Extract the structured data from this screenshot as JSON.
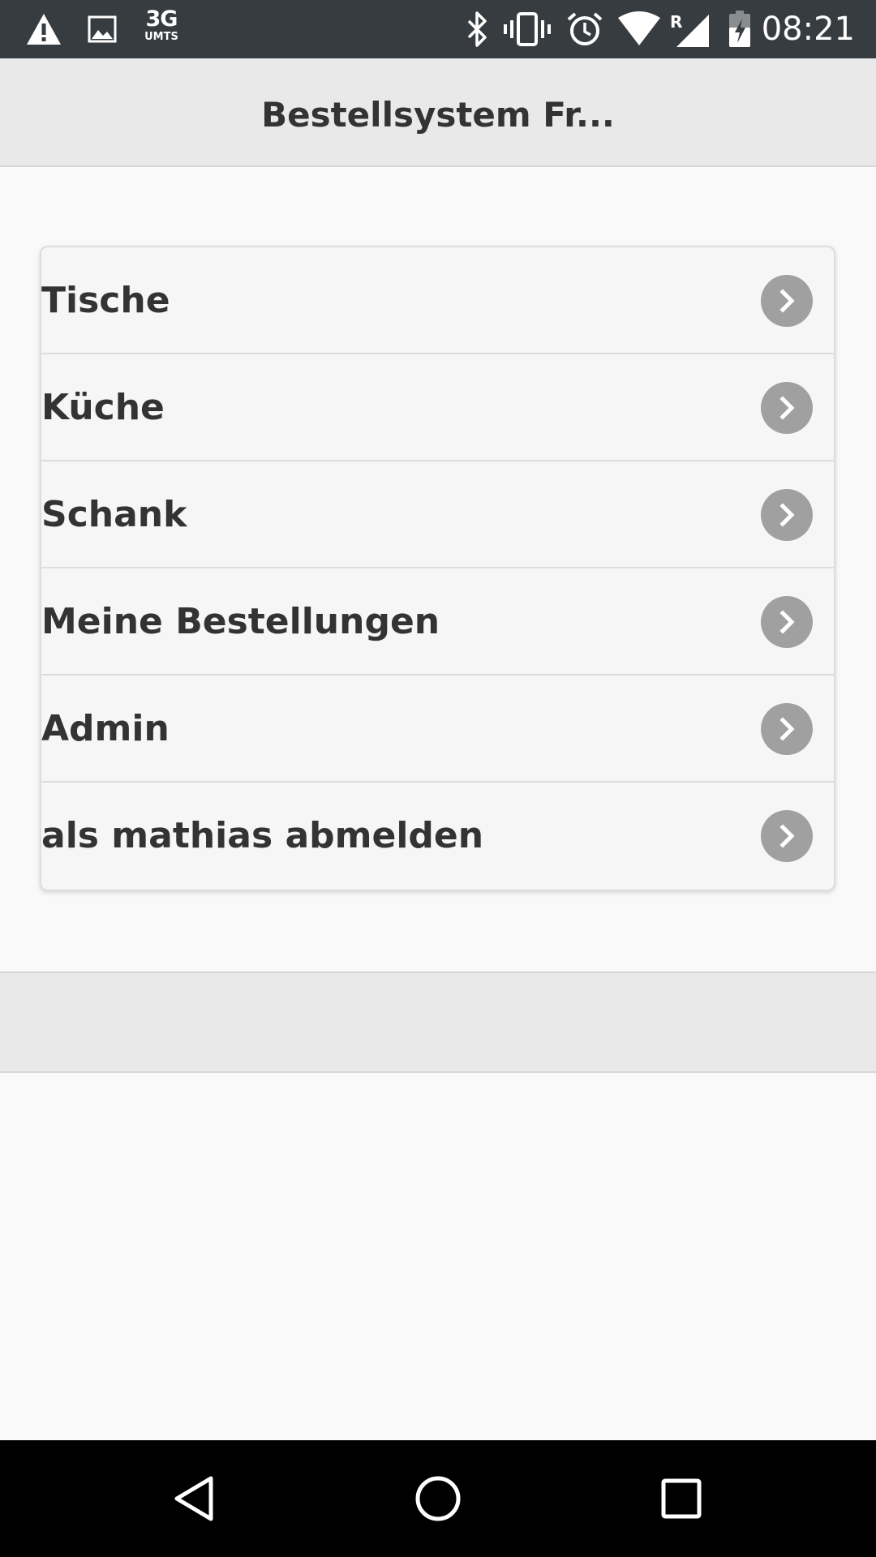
{
  "status_bar": {
    "network_type": "3G",
    "network_sub": "UMTS",
    "roaming_indicator": "R",
    "time": "08:21",
    "icons": [
      "warning-icon",
      "image-icon",
      "bluetooth-icon",
      "vibrate-icon",
      "alarm-icon",
      "wifi-icon",
      "signal-icon",
      "battery-icon"
    ]
  },
  "header": {
    "title": "Bestellsystem Fr..."
  },
  "menu": {
    "items": [
      {
        "label": "Tische",
        "icon": "chevron-right-icon"
      },
      {
        "label": "Küche",
        "icon": "chevron-right-icon"
      },
      {
        "label": "Schank",
        "icon": "chevron-right-icon"
      },
      {
        "label": "Meine Bestellungen",
        "icon": "chevron-right-icon"
      },
      {
        "label": "Admin",
        "icon": "chevron-right-icon"
      },
      {
        "label": "als mathias abmelden",
        "icon": "chevron-right-icon"
      }
    ]
  },
  "nav_bar": {
    "buttons": [
      "back-icon",
      "home-icon",
      "recents-icon"
    ]
  },
  "colors": {
    "status_bar_bg": "#373c40",
    "header_bg": "#e9e9e9",
    "page_bg": "#f9f9f9",
    "list_bg": "#f6f6f6",
    "text": "#333333",
    "chevron_bg": "#a0a0a0",
    "nav_bar_bg": "#000000"
  }
}
